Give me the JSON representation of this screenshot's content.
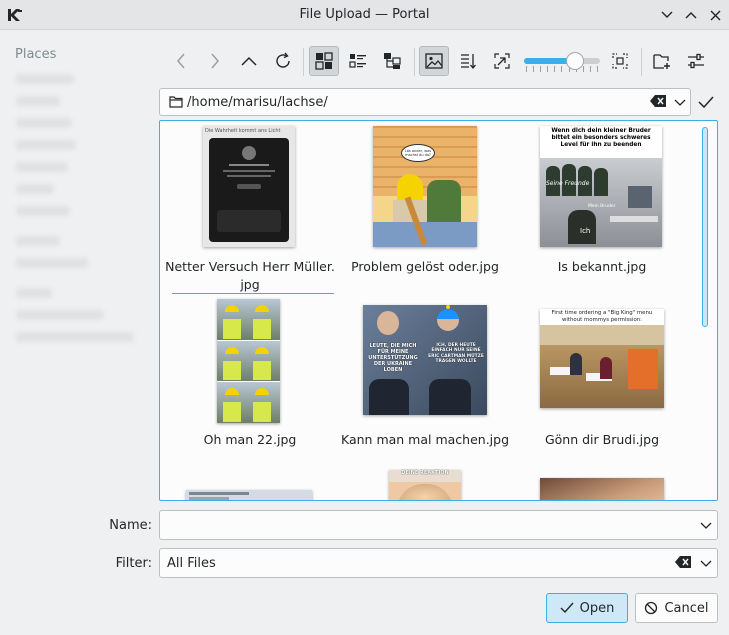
{
  "window": {
    "title": "File Upload — Portal",
    "app_icon": "kde-logo-icon",
    "controls": [
      "minimize-icon",
      "maximize-icon",
      "close-icon"
    ]
  },
  "sidebar": {
    "title": "Places",
    "items_blurred": true
  },
  "toolbar": {
    "buttons": [
      {
        "name": "back",
        "icon": "chevron-left-icon"
      },
      {
        "name": "forward",
        "icon": "chevron-right-icon"
      },
      {
        "name": "parent-folder",
        "icon": "chevron-up-icon"
      },
      {
        "name": "reload",
        "icon": "reload-icon"
      },
      {
        "name": "icons-view",
        "icon": "icons-view-icon",
        "checked": true
      },
      {
        "name": "compact-view",
        "icon": "compact-view-icon"
      },
      {
        "name": "tree-view",
        "icon": "tree-view-icon"
      },
      {
        "name": "preview",
        "icon": "image-preview-icon",
        "checked": true
      },
      {
        "name": "sort",
        "icon": "sort-icon"
      },
      {
        "name": "zoom-out",
        "icon": "zoom-out-icon"
      },
      {
        "name": "zoom-in",
        "icon": "zoom-in-icon"
      },
      {
        "name": "new-folder",
        "icon": "new-folder-icon"
      },
      {
        "name": "options",
        "icon": "options-icon"
      }
    ],
    "zoom_slider_value": 0.66
  },
  "location": {
    "path": "/home/marisu/lachse/",
    "folder_icon": "folder-icon",
    "clear_icon": "clear-icon",
    "dropdown_icon": "chevron-down-icon",
    "accept_icon": "checkmark-icon"
  },
  "files": [
    {
      "label_line1": "Netter Versuch Herr Müller.",
      "label_line2": "jpg",
      "current": true
    },
    {
      "label_line1": "Problem gelöst oder.jpg",
      "label_line2": ""
    },
    {
      "label_line1": "Is bekannt.jpg",
      "label_line2": ""
    },
    {
      "label_line1": "Oh man 22.jpg",
      "label_line2": ""
    },
    {
      "label_line1": "Kann man mal machen.jpg",
      "label_line2": ""
    },
    {
      "label_line1": "Gönn dir Brudi.jpg",
      "label_line2": ""
    }
  ],
  "thumb_texts": {
    "t1_header": "Die Wahrheit kommt ans Licht",
    "t2_bubble1": "Lös ander, was machst du da?",
    "t3_top": "Wenn dich dein kleiner Bruder bittet ein besonders schweres Level für ihn zu beenden",
    "t3_a": "Seine Freunde",
    "t3_b": "Mein Bruder",
    "t3_c": "Ich",
    "t5_left": "LEUTE, DIE MICH FÜR MEINE UNTERSTÜTZUNG DER UKRAINE LOBEN",
    "t5_right": "ICH, DER HEUTE EINFACH NUR SEINE ERIC CARTMAN MÜTZE TRAGEN WOLLTE",
    "t6_top": "First time ordering a \"Big King\" menu without mommys permission:",
    "t8_top": "DEINE REAKTION"
  },
  "form": {
    "name_label": "Name:",
    "name_value": "",
    "filter_label": "Filter:",
    "filter_value": "All Files"
  },
  "buttons": {
    "open": "Open",
    "cancel": "Cancel"
  },
  "colors": {
    "accent": "#3daee9",
    "window_bg": "#eff0f1",
    "view_bg": "#fcfcfc"
  }
}
